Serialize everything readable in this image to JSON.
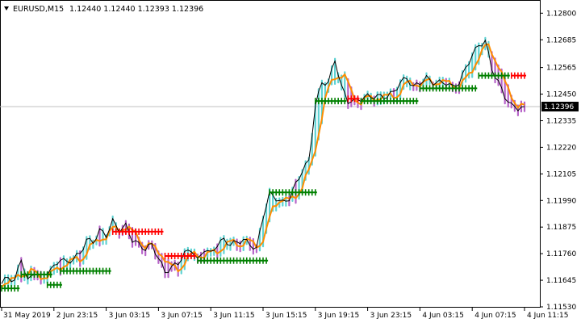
{
  "header": {
    "symbol": "EURUSD,M15",
    "ohlc": "1.12440 1.12440 1.12393 1.12396",
    "indicator_icon": "triangle-down-icon"
  },
  "current_price": {
    "value": 1.12396,
    "label": "1.12396"
  },
  "colors": {
    "background": "#ffffff",
    "axis": "#000000",
    "price_line": "#000000",
    "smooth_line": "#ff8c00",
    "bars_up": "#5fd3d3",
    "bars_down": "#b764c9",
    "arrows_up": "#008000",
    "arrows_down": "#ff0000",
    "current_price_line": "#c0c0c0",
    "current_price_box": "#000000"
  },
  "chart_data": {
    "type": "line",
    "title": "",
    "ylim": [
      1.1153,
      1.1285
    ],
    "y_ticks": [
      {
        "value": 1.128,
        "label": "1.12800"
      },
      {
        "value": 1.12685,
        "label": "1.12685"
      },
      {
        "value": 1.12565,
        "label": "1.12565"
      },
      {
        "value": 1.1245,
        "label": "1.12450"
      },
      {
        "value": 1.12335,
        "label": "1.12335"
      },
      {
        "value": 1.1222,
        "label": "1.12220"
      },
      {
        "value": 1.12105,
        "label": "1.12105"
      },
      {
        "value": 1.1199,
        "label": "1.11990"
      },
      {
        "value": 1.11875,
        "label": "1.11875"
      },
      {
        "value": 1.1176,
        "label": "1.11760"
      },
      {
        "value": 1.11645,
        "label": "1.11645"
      },
      {
        "value": 1.1153,
        "label": "1.11530"
      }
    ],
    "x_ticks": [
      {
        "index": 0,
        "label": "31 May 2019"
      },
      {
        "index": 16,
        "label": "2 Jun 23:15"
      },
      {
        "index": 32,
        "label": "3 Jun 03:15"
      },
      {
        "index": 48,
        "label": "3 Jun 07:15"
      },
      {
        "index": 64,
        "label": "3 Jun 11:15"
      },
      {
        "index": 80,
        "label": "3 Jun 15:15"
      },
      {
        "index": 96,
        "label": "3 Jun 19:15"
      },
      {
        "index": 112,
        "label": "3 Jun 23:15"
      },
      {
        "index": 128,
        "label": "4 Jun 03:15"
      },
      {
        "index": 144,
        "label": "4 Jun 07:15"
      },
      {
        "index": 160,
        "label": "4 Jun 11:15"
      }
    ],
    "bar_count": 161,
    "price_keypoints": [
      [
        0,
        1.1163
      ],
      [
        2,
        1.1166
      ],
      [
        4,
        1.1164
      ],
      [
        6,
        1.1174
      ],
      [
        8,
        1.1164
      ],
      [
        10,
        1.1168
      ],
      [
        12,
        1.1166
      ],
      [
        14,
        1.1168
      ],
      [
        16,
        1.117
      ],
      [
        18,
        1.1174
      ],
      [
        20,
        1.1172
      ],
      [
        22,
        1.1174
      ],
      [
        24,
        1.1176
      ],
      [
        26,
        1.1182
      ],
      [
        28,
        1.1181
      ],
      [
        30,
        1.1186
      ],
      [
        32,
        1.1184
      ],
      [
        34,
        1.119
      ],
      [
        36,
        1.1186
      ],
      [
        38,
        1.1188
      ],
      [
        40,
        1.1182
      ],
      [
        42,
        1.118
      ],
      [
        44,
        1.1178
      ],
      [
        46,
        1.118
      ],
      [
        48,
        1.1174
      ],
      [
        50,
        1.1168
      ],
      [
        52,
        1.117
      ],
      [
        54,
        1.1172
      ],
      [
        56,
        1.1176
      ],
      [
        58,
        1.1178
      ],
      [
        60,
        1.1173
      ],
      [
        62,
        1.1178
      ],
      [
        64,
        1.1176
      ],
      [
        66,
        1.118
      ],
      [
        68,
        1.1182
      ],
      [
        70,
        1.118
      ],
      [
        72,
        1.1181
      ],
      [
        74,
        1.1182
      ],
      [
        76,
        1.118
      ],
      [
        78,
        1.1178
      ],
      [
        80,
        1.1192
      ],
      [
        82,
        1.1202
      ],
      [
        84,
        1.12
      ],
      [
        86,
        1.1198
      ],
      [
        88,
        1.12
      ],
      [
        90,
        1.1206
      ],
      [
        92,
        1.1212
      ],
      [
        94,
        1.1216
      ],
      [
        96,
        1.124
      ],
      [
        98,
        1.125
      ],
      [
        100,
        1.125
      ],
      [
        102,
        1.126
      ],
      [
        104,
        1.1248
      ],
      [
        106,
        1.1242
      ],
      [
        108,
        1.1242
      ],
      [
        110,
        1.1243
      ],
      [
        112,
        1.1244
      ],
      [
        114,
        1.1244
      ],
      [
        116,
        1.1244
      ],
      [
        118,
        1.1244
      ],
      [
        120,
        1.1246
      ],
      [
        122,
        1.125
      ],
      [
        124,
        1.1252
      ],
      [
        126,
        1.1248
      ],
      [
        128,
        1.125
      ],
      [
        130,
        1.1252
      ],
      [
        132,
        1.125
      ],
      [
        134,
        1.125
      ],
      [
        136,
        1.125
      ],
      [
        138,
        1.1248
      ],
      [
        140,
        1.125
      ],
      [
        142,
        1.1256
      ],
      [
        144,
        1.1262
      ],
      [
        146,
        1.1266
      ],
      [
        148,
        1.1268
      ],
      [
        150,
        1.1256
      ],
      [
        152,
        1.125
      ],
      [
        154,
        1.1244
      ],
      [
        156,
        1.124
      ],
      [
        158,
        1.1239
      ],
      [
        160,
        1.12396
      ]
    ],
    "smooth_offset": 0.0003
  }
}
